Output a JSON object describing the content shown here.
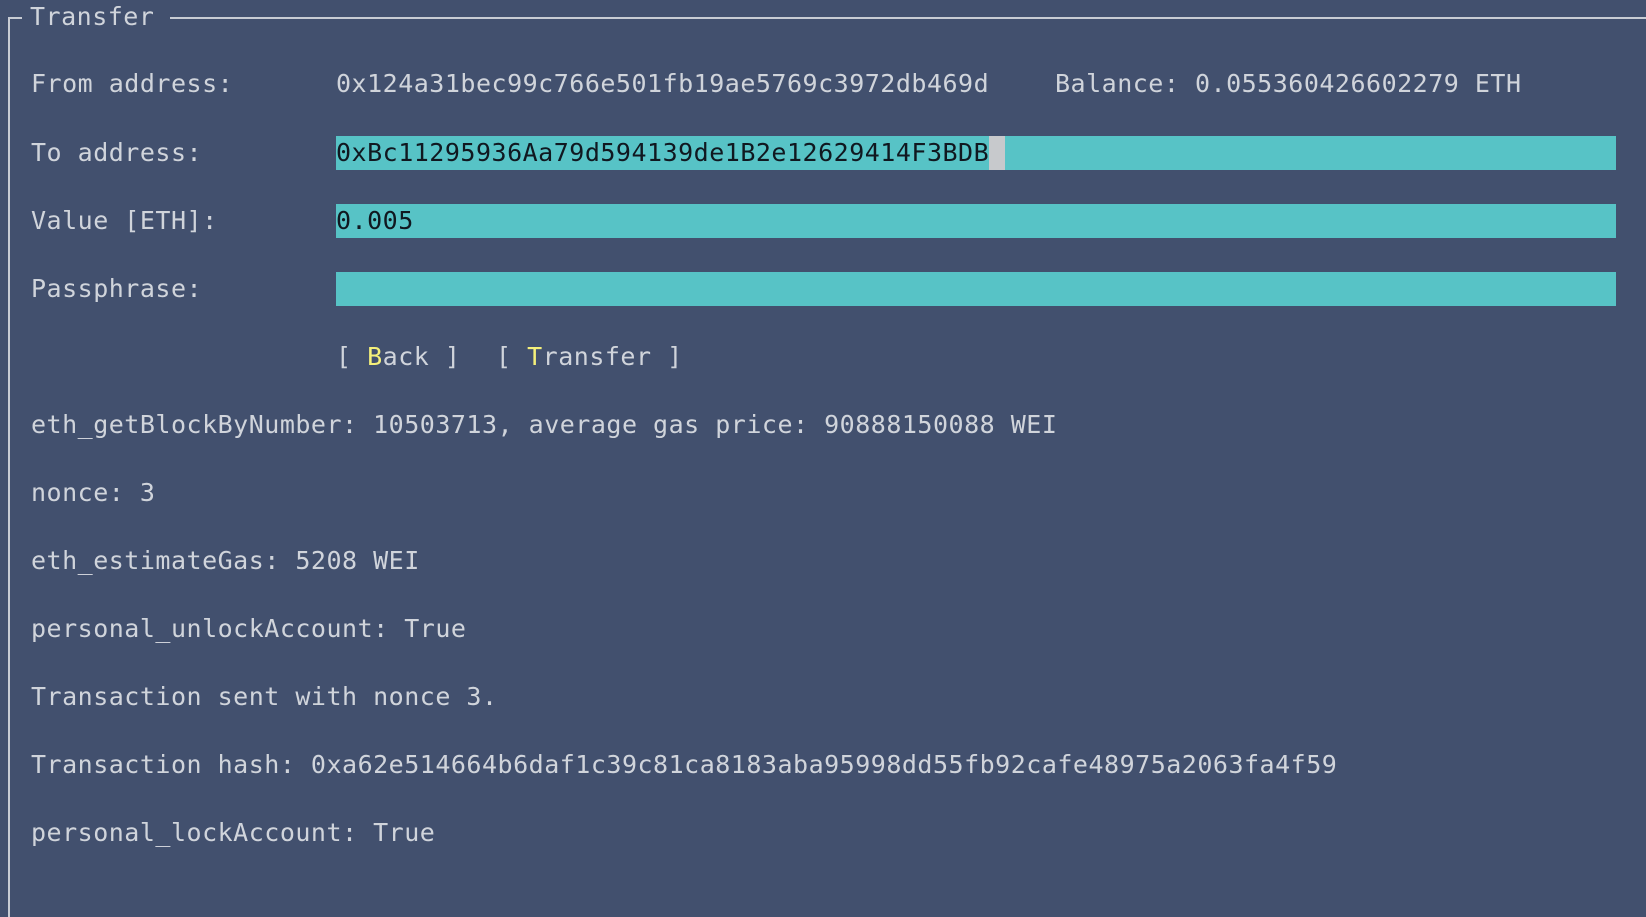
{
  "panel": {
    "title": "Transfer"
  },
  "from": {
    "label": "From address:",
    "address": "0x124a31bec99c766e501fb19ae5769c3972db469d",
    "balance_text": "Balance: 0.055360426602279 ETH"
  },
  "to": {
    "label": "To address:",
    "value": "0xBc11295936Aa79d594139de1B2e12629414F3BDB"
  },
  "amount": {
    "label": "Value [ETH]:",
    "value": "0.005"
  },
  "passphrase": {
    "label": "Passphrase:",
    "value": ""
  },
  "buttons": {
    "back": {
      "open": "[ ",
      "hotkey": "B",
      "rest": "ack",
      "close": " ]"
    },
    "transfer": {
      "open": "[ ",
      "hotkey": "T",
      "rest": "ransfer",
      "close": " ]"
    }
  },
  "log": [
    "eth_getBlockByNumber: 10503713, average gas price: 90888150088 WEI",
    "nonce: 3",
    "eth_estimateGas: 5208 WEI",
    "personal_unlockAccount: True",
    "Transaction sent with nonce 3.",
    "Transaction hash: 0xa62e514664b6daf1c39c81ca8183aba95998dd55fb92cafe48975a2063fa4f59",
    "personal_lockAccount: True"
  ],
  "colors": {
    "background": "#42506e",
    "field": "#57c3c6",
    "hotkey": "#f5f07a",
    "text": "#d0d4db"
  }
}
